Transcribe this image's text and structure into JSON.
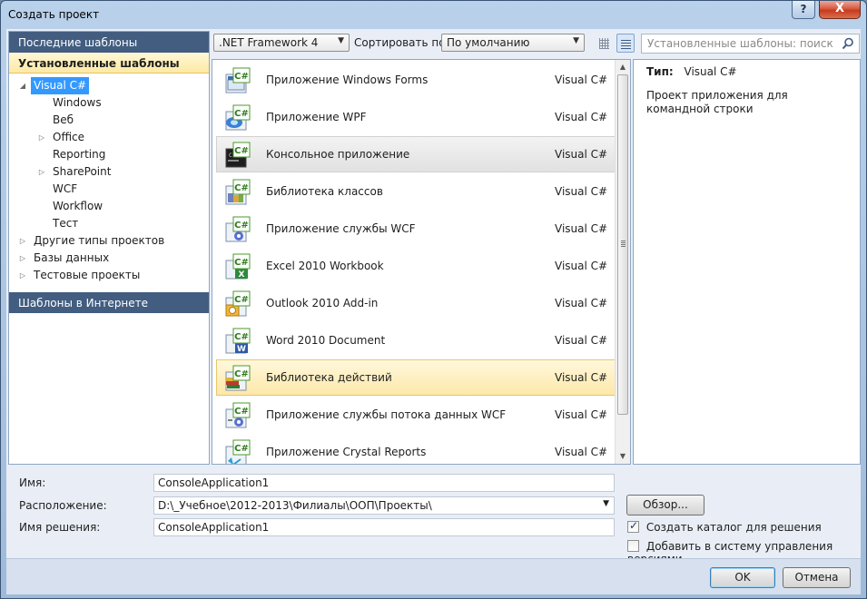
{
  "window": {
    "title": "Создать проект",
    "close": "X",
    "help": "?"
  },
  "left": {
    "recent": "Последние шаблоны",
    "installed": "Установленные шаблоны",
    "online": "Шаблоны в Интернете",
    "tree": [
      {
        "label": "Visual C#",
        "level": 0,
        "expand": "◢",
        "selected": true
      },
      {
        "label": "Windows",
        "level": 1,
        "expand": ""
      },
      {
        "label": "Веб",
        "level": 1,
        "expand": ""
      },
      {
        "label": "Office",
        "level": 1,
        "expand": "▷"
      },
      {
        "label": "Reporting",
        "level": 1,
        "expand": ""
      },
      {
        "label": "SharePoint",
        "level": 1,
        "expand": "▷"
      },
      {
        "label": "WCF",
        "level": 1,
        "expand": ""
      },
      {
        "label": "Workflow",
        "level": 1,
        "expand": ""
      },
      {
        "label": "Тест",
        "level": 1,
        "expand": ""
      },
      {
        "label": "Другие типы проектов",
        "level": 0,
        "expand": "▷"
      },
      {
        "label": "Базы данных",
        "level": 0,
        "expand": "▷"
      },
      {
        "label": "Тестовые проекты",
        "level": 0,
        "expand": "▷"
      }
    ]
  },
  "toolbar": {
    "framework": ".NET Framework 4",
    "sort_label": "Сортировать по:",
    "sort_value": "По умолчанию",
    "search_placeholder": "Установленные шаблоны: поиск"
  },
  "templates": [
    {
      "name": "Приложение Windows Forms",
      "lang": "Visual C#",
      "icon": "windows-forms-icon",
      "state": ""
    },
    {
      "name": "Приложение WPF",
      "lang": "Visual C#",
      "icon": "wpf-icon",
      "state": ""
    },
    {
      "name": "Консольное приложение",
      "lang": "Visual C#",
      "icon": "console-icon",
      "state": "hover"
    },
    {
      "name": "Библиотека классов",
      "lang": "Visual C#",
      "icon": "class-library-icon",
      "state": ""
    },
    {
      "name": "Приложение службы WCF",
      "lang": "Visual C#",
      "icon": "wcf-service-icon",
      "state": ""
    },
    {
      "name": "Excel 2010 Workbook",
      "lang": "Visual C#",
      "icon": "excel-icon",
      "state": ""
    },
    {
      "name": "Outlook 2010 Add-in",
      "lang": "Visual C#",
      "icon": "outlook-icon",
      "state": ""
    },
    {
      "name": "Word 2010 Document",
      "lang": "Visual C#",
      "icon": "word-icon",
      "state": ""
    },
    {
      "name": "Библиотека действий",
      "lang": "Visual C#",
      "icon": "activity-library-icon",
      "state": "sel"
    },
    {
      "name": "Приложение службы потока данных WCF",
      "lang": "Visual C#",
      "icon": "wcf-workflow-icon",
      "state": ""
    },
    {
      "name": "Приложение Crystal Reports",
      "lang": "Visual C#",
      "icon": "crystal-reports-icon",
      "state": ""
    }
  ],
  "detail": {
    "type_label": "Тип:",
    "type_value": "Visual C#",
    "description": "Проект приложения для командной строки"
  },
  "form": {
    "name_label": "Имя:",
    "name_value": "ConsoleApplication1",
    "location_label": "Расположение:",
    "location_value": "D:\\_Учебное\\2012-2013\\Филиалы\\ООП\\Проекты\\",
    "solution_label": "Имя решения:",
    "solution_value": "ConsoleApplication1",
    "browse": "Обзор...",
    "create_dir": "Создать каталог для решения",
    "create_dir_checked": true,
    "source_control": "Добавить в систему управления версиями",
    "source_control_checked": false
  },
  "buttons": {
    "ok": "OK",
    "cancel": "Отмена"
  }
}
